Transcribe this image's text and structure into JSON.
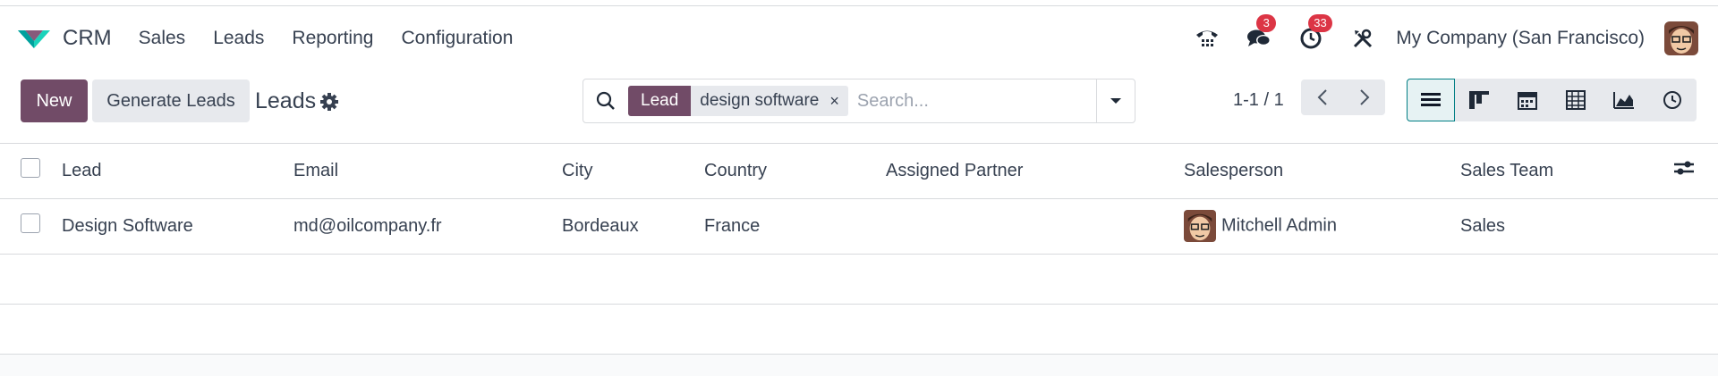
{
  "navbar": {
    "app_name": "CRM",
    "menu": [
      "Sales",
      "Leads",
      "Reporting",
      "Configuration"
    ],
    "messages_badge": "3",
    "activities_badge": "33",
    "company": "My Company (San Francisco)"
  },
  "control": {
    "new_label": "New",
    "generate_label": "Generate Leads",
    "title": "Leads",
    "search": {
      "facet_category": "Lead",
      "facet_value": "design software",
      "facet_remove": "×",
      "placeholder": "Search..."
    },
    "pager": "1-1 / 1"
  },
  "table": {
    "columns": [
      "Lead",
      "Email",
      "City",
      "Country",
      "Assigned Partner",
      "Salesperson",
      "Sales Team"
    ],
    "rows": [
      {
        "lead": "Design Software",
        "email": "md@oilcompany.fr",
        "city": "Bordeaux",
        "country": "France",
        "assigned_partner": "",
        "salesperson": "Mitchell Admin",
        "sales_team": "Sales"
      }
    ]
  },
  "colors": {
    "brand": "#714b67",
    "accent": "#017e84",
    "badge": "#dc3545"
  }
}
